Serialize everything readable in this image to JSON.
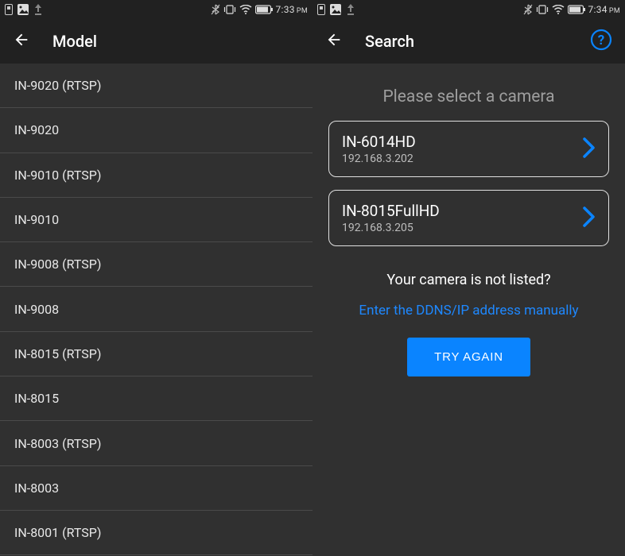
{
  "left": {
    "status": {
      "time": "7:33",
      "ampm": "PM"
    },
    "title": "Model",
    "items": [
      "IN-9020 (RTSP)",
      "IN-9020",
      "IN-9010 (RTSP)",
      "IN-9010",
      "IN-9008 (RTSP)",
      "IN-9008",
      "IN-8015 (RTSP)",
      "IN-8015",
      "IN-8003 (RTSP)",
      "IN-8003",
      "IN-8001 (RTSP)"
    ]
  },
  "right": {
    "status": {
      "time": "7:34",
      "ampm": "PM"
    },
    "title": "Search",
    "prompt": "Please select a camera",
    "cameras": [
      {
        "name": "IN-6014HD",
        "ip": "192.168.3.202"
      },
      {
        "name": "IN-8015FullHD",
        "ip": "192.168.3.205"
      }
    ],
    "not_listed": "Your camera is not listed?",
    "manual_link": "Enter the DDNS/IP address manually",
    "try_again": "TRY AGAIN"
  }
}
